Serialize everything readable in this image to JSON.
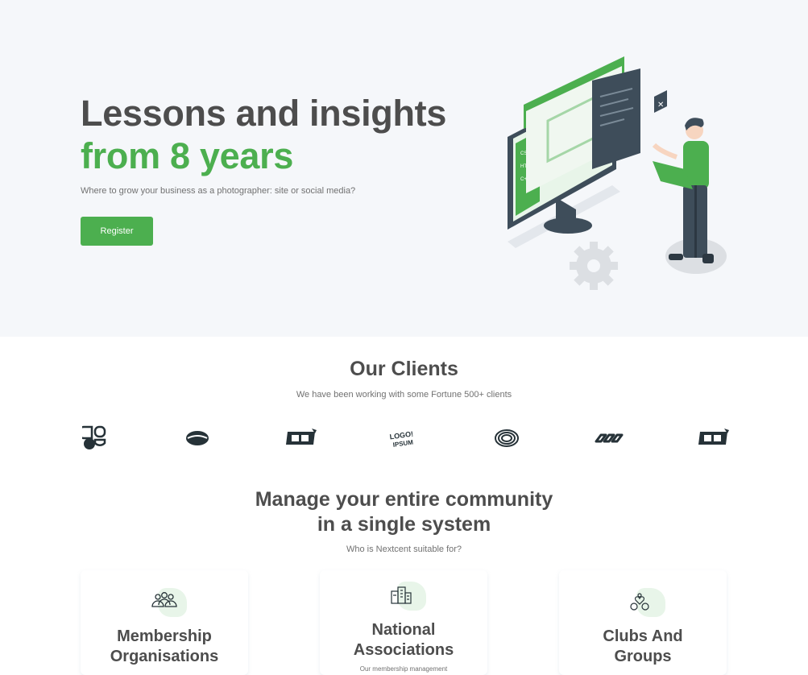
{
  "hero": {
    "title_line1": "Lessons and insights",
    "title_line2": "from 8 years",
    "subtitle": "Where to grow your business as a photographer: site or social media?",
    "register_label": "Register",
    "illustration_labels": {
      "css": "CSS",
      "html": "HTML",
      "cpp": "C++"
    }
  },
  "clients": {
    "title": "Our Clients",
    "subtitle": "We have been working with some Fortune 500+ clients",
    "logos": [
      "logo-1",
      "logo-2",
      "logo-3",
      "logo-4",
      "logo-5",
      "logo-6",
      "logo-7"
    ],
    "logo_text": {
      "logo4_line1": "LOGO!",
      "logo4_line2": "IPSUM"
    }
  },
  "community": {
    "title_line1": "Manage your entire community",
    "title_line2": "in a single system",
    "subtitle": "Who is Nextcent suitable for?",
    "cards": [
      {
        "title_line1": "Membership",
        "title_line2": "Organisations",
        "icon": "people-group-icon",
        "desc": ""
      },
      {
        "title_line1": "National",
        "title_line2": "Associations",
        "icon": "buildings-icon",
        "desc": "Our membership management"
      },
      {
        "title_line1": "Clubs And",
        "title_line2": "Groups",
        "icon": "hand-heart-icon",
        "desc": ""
      }
    ]
  },
  "colors": {
    "primary": "#4caf4f",
    "heading": "#4d4d4d",
    "text": "#717171",
    "hero_bg": "#f5f7fa"
  }
}
